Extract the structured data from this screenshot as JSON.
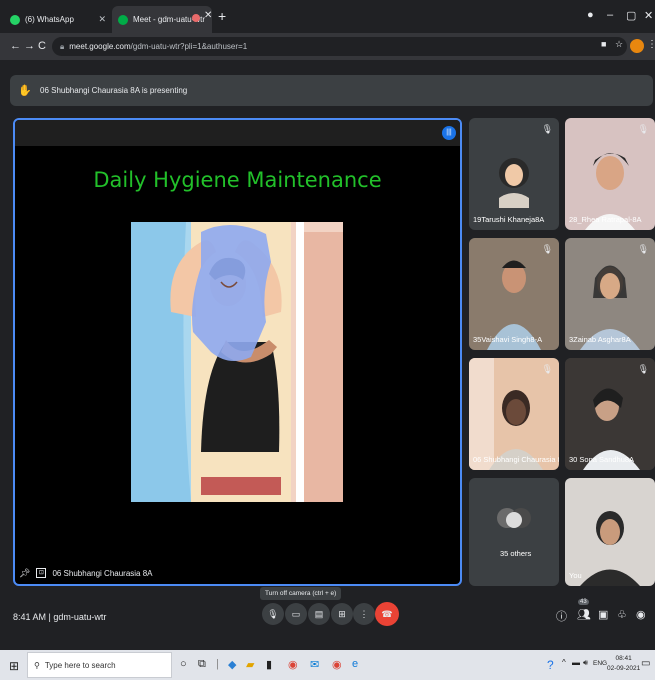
{
  "browser": {
    "tabs": [
      {
        "label": "(6) WhatsApp",
        "favicon_color": "#25d366",
        "active": false
      },
      {
        "label": "Meet - gdm-uatu-wtr",
        "favicon_color": "#00ac47",
        "active": true
      }
    ],
    "new_tab_symbol": "+",
    "address": {
      "host": "meet.google.com",
      "path": "/gdm-uatu-wtr?pli=1&authuser=1"
    }
  },
  "meet": {
    "presenting_banner": "06 Shubhangi Chaurasia 8A is presenting",
    "slide_title": "Daily Hygiene Maintenance",
    "stage_owner": "06 Shubhangi Chaurasia 8A",
    "participants": [
      {
        "name": "19Tarushi Khaneja8A"
      },
      {
        "name": "28_Rhea Ratrapal-8A"
      },
      {
        "name": "35Vaishavi Singh8-A"
      },
      {
        "name": "3Zainab Asghar8A"
      },
      {
        "name": "06 Shubhangi Chaurasia 8A"
      },
      {
        "name": "30 Sona Sandhu8A"
      },
      {
        "name": "35 others"
      },
      {
        "name": "You"
      }
    ],
    "tooltip": "Turn off camera (ctrl + e)",
    "meeting_time": "8:41 AM",
    "meeting_code": "gdm-uatu-wtr",
    "people_count": "43"
  },
  "taskbar": {
    "search_placeholder": "Type here to search",
    "lang": "ENG",
    "time": "08:41",
    "date": "02-09-2021"
  },
  "colors": {
    "accent": "#1a73e8",
    "slide_title": "#22c02a",
    "end_call": "#ea4335",
    "stage_border": "#4c8bf5"
  }
}
